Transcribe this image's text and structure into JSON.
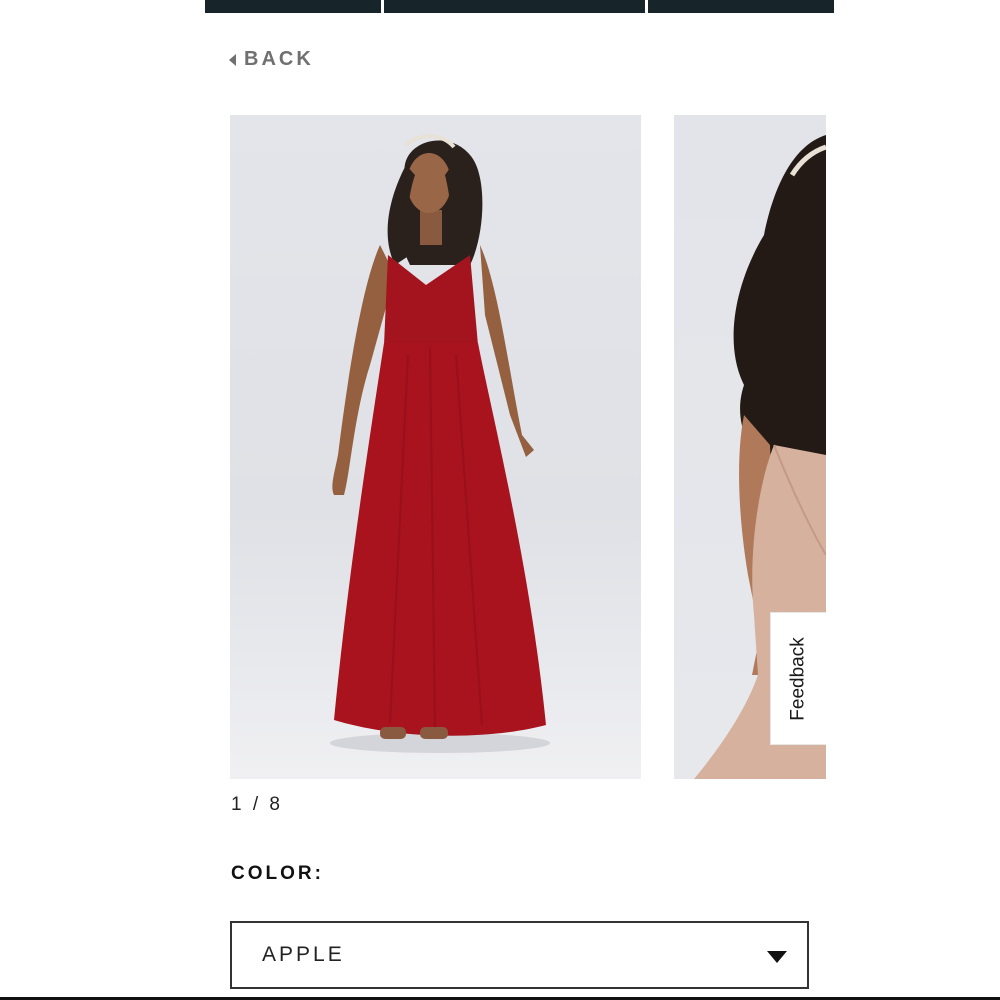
{
  "nav": {
    "back_label": "BACK"
  },
  "gallery": {
    "counter": "1 / 8",
    "images": [
      {
        "description_icon": "model-red-dress-photo",
        "dress_color": "#a3141f"
      },
      {
        "description_icon": "model-blush-dress-photo",
        "dress_color": "#d8b3a0"
      }
    ]
  },
  "feedback": {
    "label": "Feedback"
  },
  "color": {
    "label": "COLOR:",
    "selected": "APPLE"
  },
  "colors": {
    "topbar": "#17252a",
    "text_muted": "#707070"
  }
}
